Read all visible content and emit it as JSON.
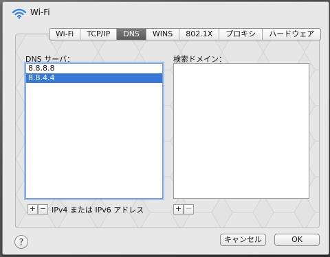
{
  "window": {
    "title": "Wi-Fi"
  },
  "tabs": [
    {
      "label": "Wi-Fi",
      "active": false
    },
    {
      "label": "TCP/IP",
      "active": false
    },
    {
      "label": "DNS",
      "active": true
    },
    {
      "label": "WINS",
      "active": false
    },
    {
      "label": "802.1X",
      "active": false
    },
    {
      "label": "プロキシ",
      "active": false
    },
    {
      "label": "ハードウェア",
      "active": false
    }
  ],
  "dns": {
    "label": "DNS サーバ：",
    "servers": [
      "8.8.8.8",
      "8.8.4.4"
    ],
    "selected_index": 1,
    "add": "+",
    "remove": "−",
    "hint": "IPv4 または IPv6 アドレス"
  },
  "search": {
    "label": "検索ドメイン：",
    "domains": [],
    "add": "+",
    "remove": "−"
  },
  "footer": {
    "help": "?",
    "cancel": "キャンセル",
    "ok": "OK"
  },
  "colors": {
    "selection": "#3878d7",
    "active_tab": "#6a6a6a",
    "focus_ring": "#6fa0df"
  }
}
